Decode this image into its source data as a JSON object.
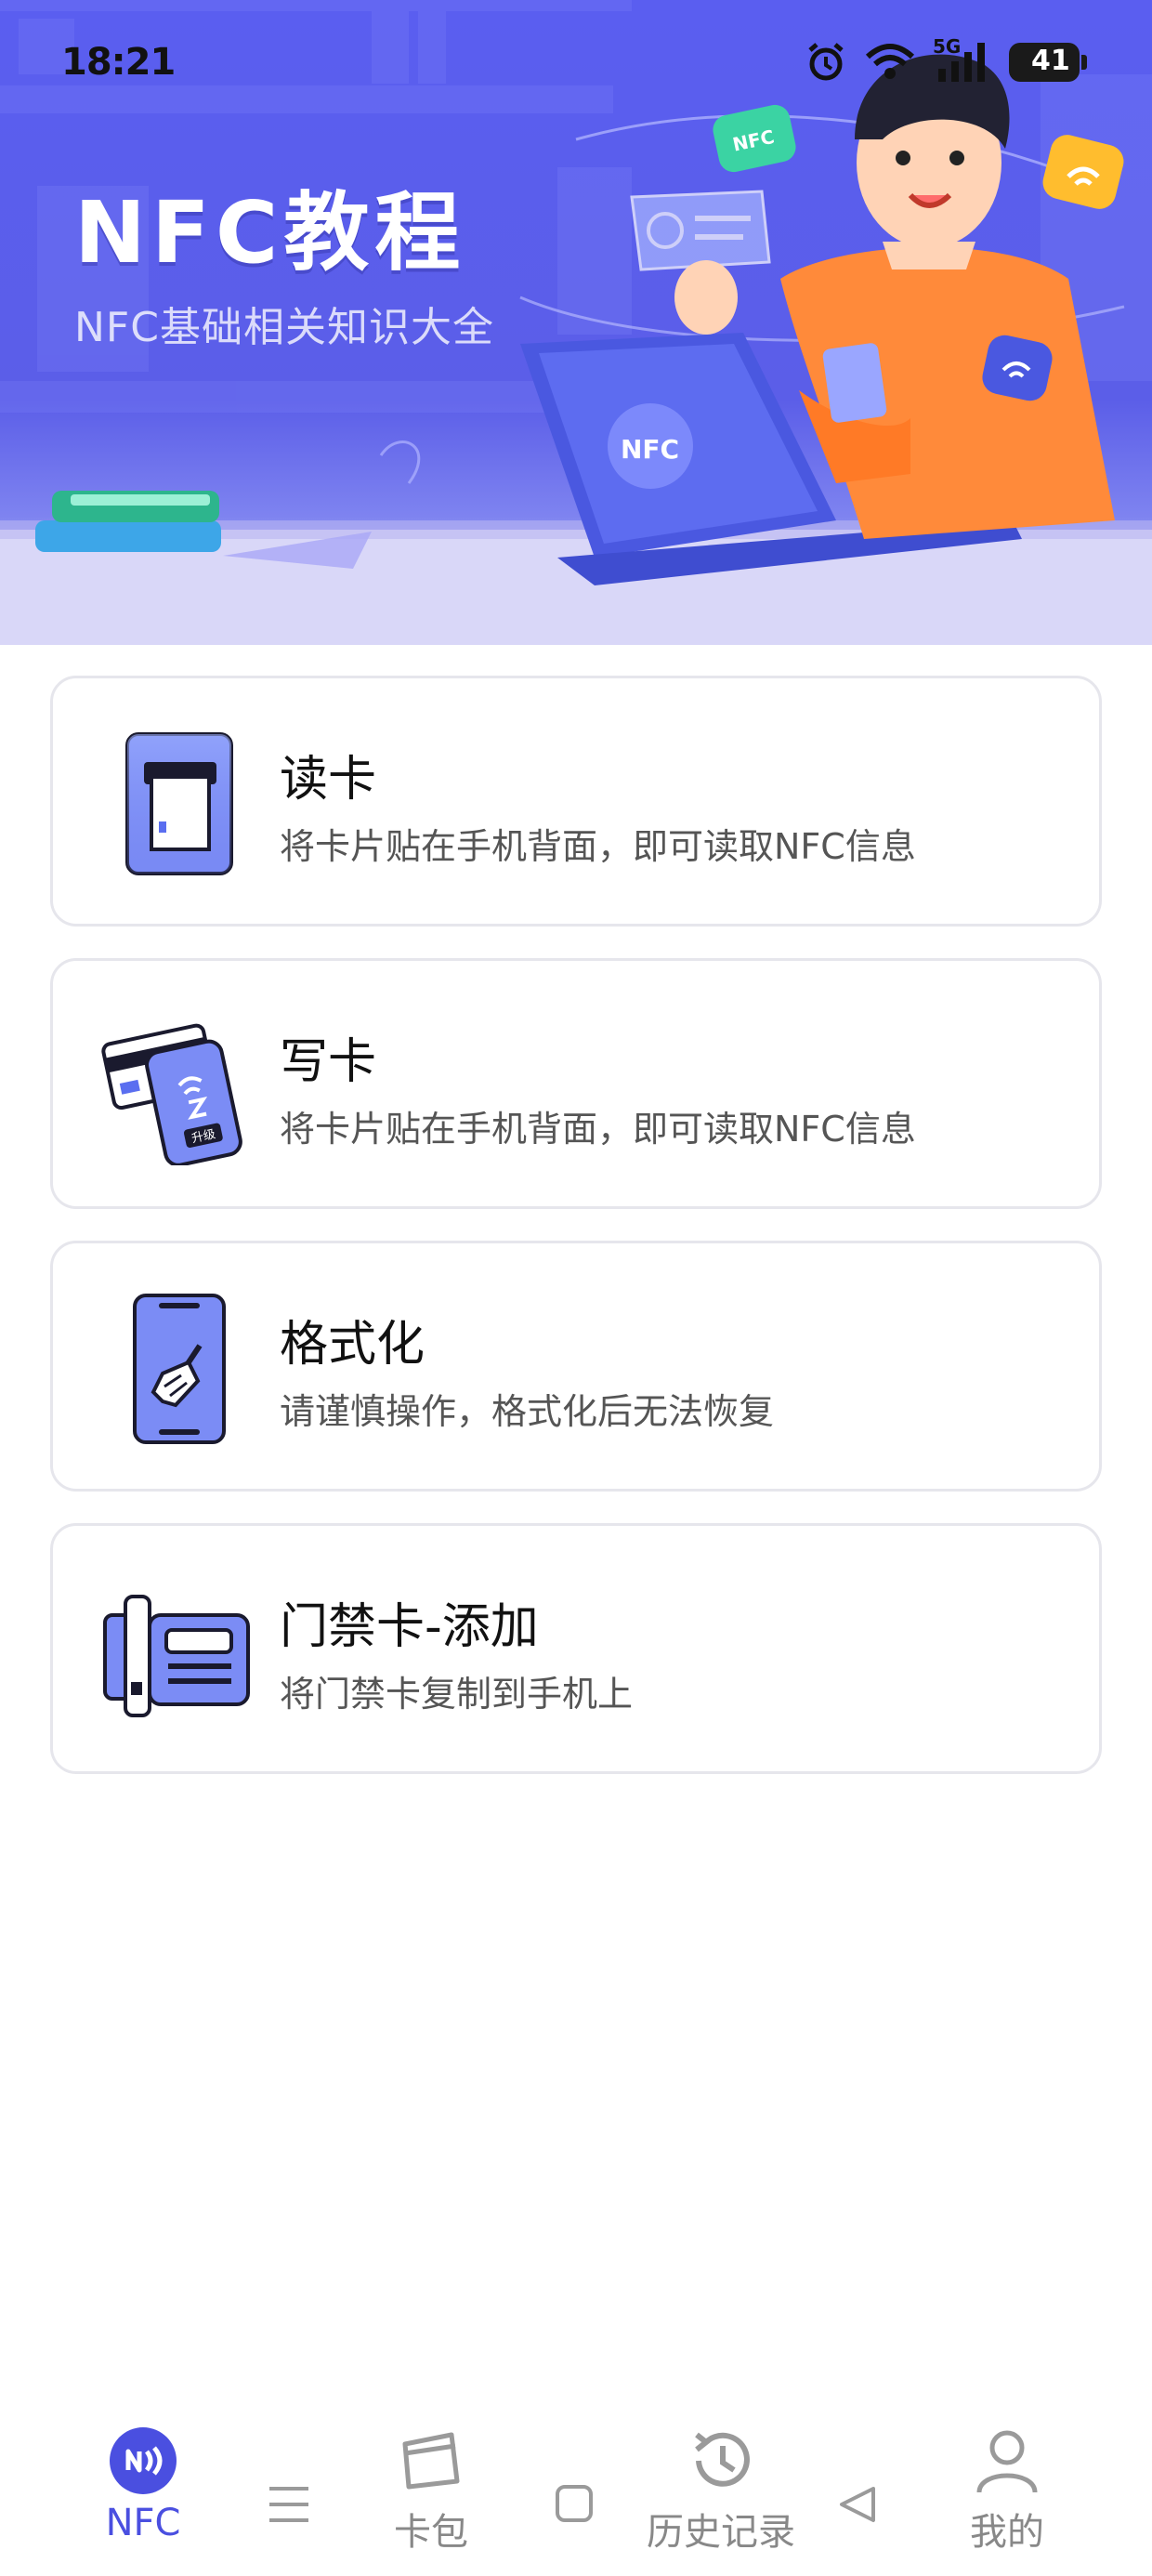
{
  "status_bar": {
    "time": "18:21",
    "network_label": "5G",
    "battery_level": "41"
  },
  "banner": {
    "title": "NFC教程",
    "subtitle": "NFC基础相关知识大全",
    "illustration_badges": [
      "NFC",
      "NFC"
    ]
  },
  "cards": [
    {
      "title": "读卡",
      "desc": "将卡片贴在手机背面，即可读取NFC信息",
      "icon": "read-card-icon"
    },
    {
      "title": "写卡",
      "desc": "将卡片贴在手机背面，即可读取NFC信息",
      "icon": "write-card-icon"
    },
    {
      "title": "格式化",
      "desc": "请谨慎操作，格式化后无法恢复",
      "icon": "format-icon"
    },
    {
      "title": "门禁卡-添加",
      "desc": "将门禁卡复制到手机上",
      "icon": "access-card-icon"
    }
  ],
  "write_card_phone_label": "升级",
  "bottom_nav": {
    "items": [
      {
        "label": "NFC",
        "icon": "nfc-icon",
        "active": true
      },
      {
        "label": "卡包",
        "icon": "card-wallet-icon",
        "active": false
      },
      {
        "label": "历史记录",
        "icon": "history-icon",
        "active": false
      },
      {
        "label": "我的",
        "icon": "profile-icon",
        "active": false
      }
    ],
    "system_buttons": [
      "menu-icon",
      "home-icon",
      "back-icon"
    ]
  },
  "colors": {
    "brand": "#5a5ef0",
    "active_nav": "#4a4fe0",
    "card_border": "#e6e6ec",
    "text_primary": "#111111",
    "text_secondary": "#555555",
    "nav_inactive": "#888888"
  }
}
